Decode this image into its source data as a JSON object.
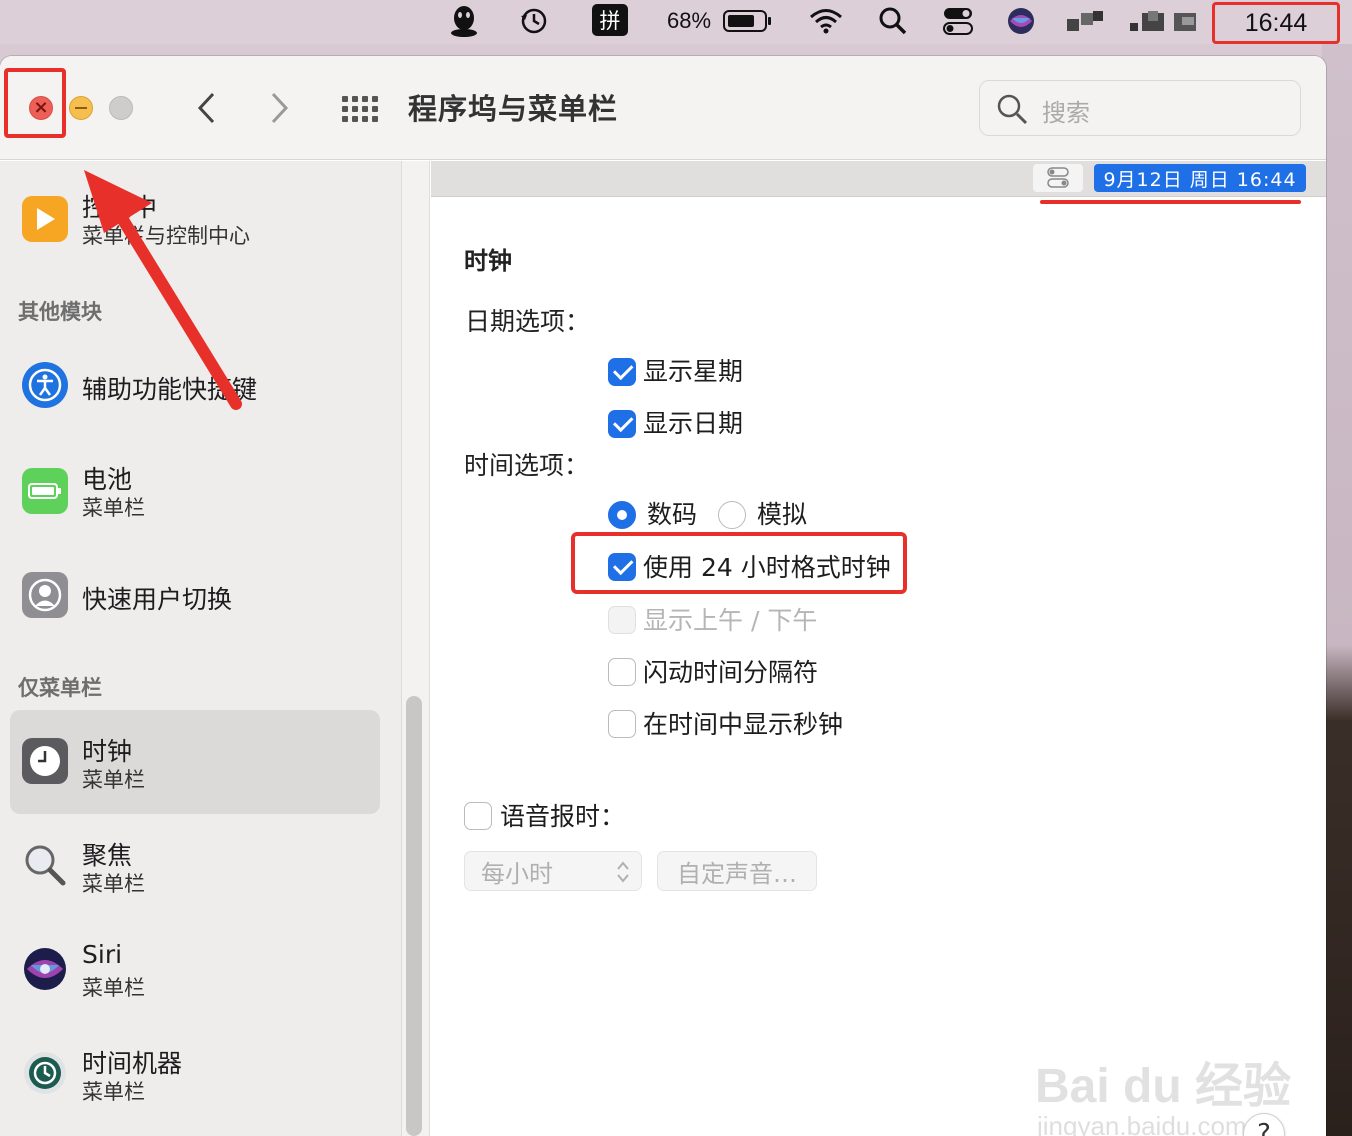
{
  "menubar": {
    "input_method": "拼",
    "battery_percent": "68%",
    "time": "16:44"
  },
  "window": {
    "title": "程序坞与菜单栏",
    "search_placeholder": "搜索"
  },
  "sidebar": {
    "top_item": {
      "title": "控制中",
      "subtitle": "菜单栏与控制中心"
    },
    "section_other": "其他模块",
    "section_menubar_only": "仅菜单栏",
    "items": [
      {
        "title": "辅助功能快捷键",
        "subtitle": ""
      },
      {
        "title": "电池",
        "subtitle": "菜单栏"
      },
      {
        "title": "快速用户切换",
        "subtitle": ""
      },
      {
        "title": "时钟",
        "subtitle": "菜单栏"
      },
      {
        "title": "聚焦",
        "subtitle": "菜单栏"
      },
      {
        "title": "Siri",
        "subtitle": "菜单栏"
      },
      {
        "title": "时间机器",
        "subtitle": "菜单栏"
      }
    ]
  },
  "preview": {
    "date_text": "9月12日 周日  16:44"
  },
  "clock": {
    "section_title": "时钟",
    "date_options_label": "日期选项：",
    "show_weekday": {
      "label": "显示星期",
      "checked": true
    },
    "show_date": {
      "label": "显示日期",
      "checked": true
    },
    "time_options_label": "时间选项：",
    "radio_digital": {
      "label": "数码",
      "selected": true
    },
    "radio_analog": {
      "label": "模拟",
      "selected": false
    },
    "use_24h": {
      "label": "使用 24 小时格式时钟",
      "checked": true
    },
    "show_ampm": {
      "label": "显示上午 / 下午",
      "checked": false,
      "disabled": true
    },
    "flash_separators": {
      "label": "闪动时间分隔符",
      "checked": false
    },
    "show_seconds": {
      "label": "在时间中显示秒钟",
      "checked": false
    },
    "announce_time": {
      "label": "语音报时：",
      "checked": false
    },
    "interval_select": "每小时",
    "custom_voice_button": "自定声音…",
    "help_button": "?"
  },
  "watermark": {
    "brand": "Bai du 经验",
    "url": "jingyan.baidu.com"
  },
  "colors": {
    "accent": "#1f6fe6",
    "annotation_red": "#e8302a",
    "close_red": "#ee5f57",
    "minimize_yellow": "#f6be4f"
  }
}
